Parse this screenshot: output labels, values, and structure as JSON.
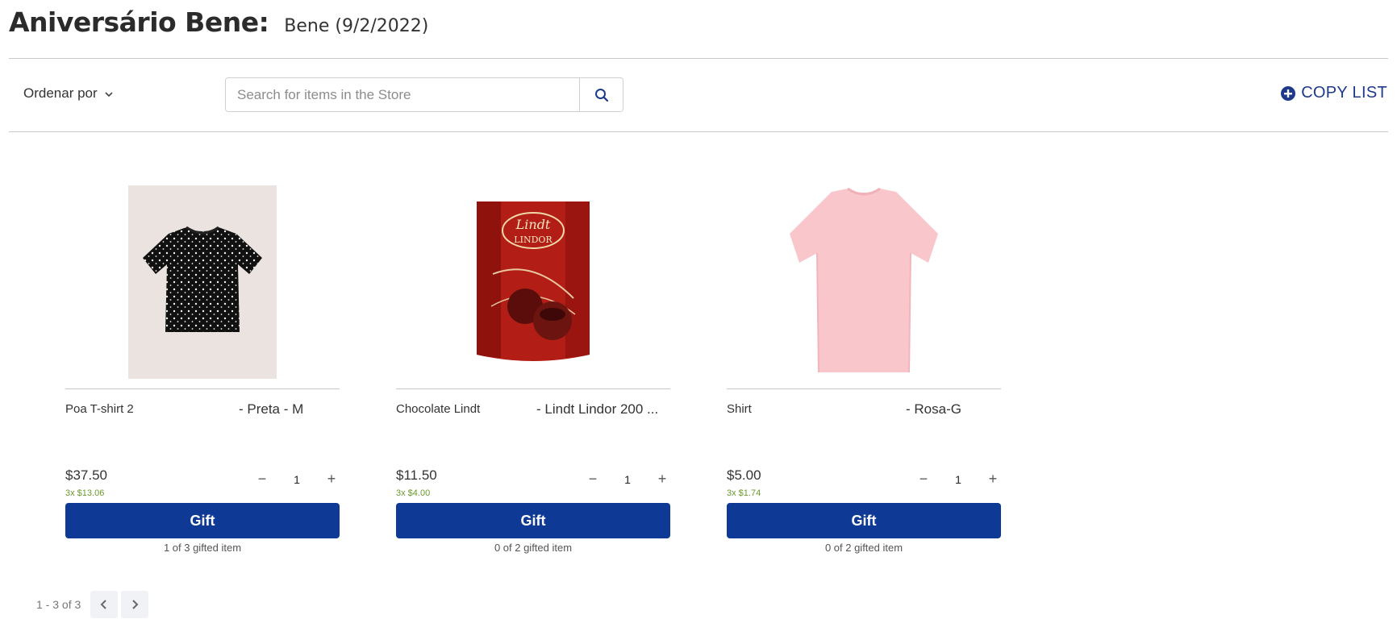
{
  "header": {
    "title": "Aniversário Bene:",
    "subtitle": "Bene (9/2/2022)"
  },
  "toolbar": {
    "sort_label": "Ordenar por",
    "search_placeholder": "Search for items in the Store",
    "copy_list_label": "COPY LIST"
  },
  "products": [
    {
      "name": "Poa T-shirt 2",
      "variant": "- Preta - M",
      "price": "$37.50",
      "installment": "3x $13.06",
      "quantity": "1",
      "gift_label": "Gift",
      "gifted_text": "1 of 3 gifted item",
      "image_icon": "black-polka-dot-tshirt-image"
    },
    {
      "name": "Chocolate Lindt",
      "variant": "- Lindt Lindor 200 ...",
      "price": "$11.50",
      "installment": "3x $4.00",
      "quantity": "1",
      "gift_label": "Gift",
      "gifted_text": "0 of 2 gifted item",
      "image_icon": "lindt-chocolate-box-image",
      "brand_text": "Lindt",
      "brand_sub": "LINDOR"
    },
    {
      "name": "Shirt",
      "variant": "- Rosa-G",
      "price": "$5.00",
      "installment": "3x $1.74",
      "quantity": "1",
      "gift_label": "Gift",
      "gifted_text": "0 of 2 gifted item",
      "image_icon": "pink-tshirt-image"
    }
  ],
  "pagination": {
    "label": "1 - 3 of 3"
  },
  "colors": {
    "primary": "#0e3a95",
    "accent_link": "#1f3a8a",
    "installment": "#6a9a2c"
  }
}
